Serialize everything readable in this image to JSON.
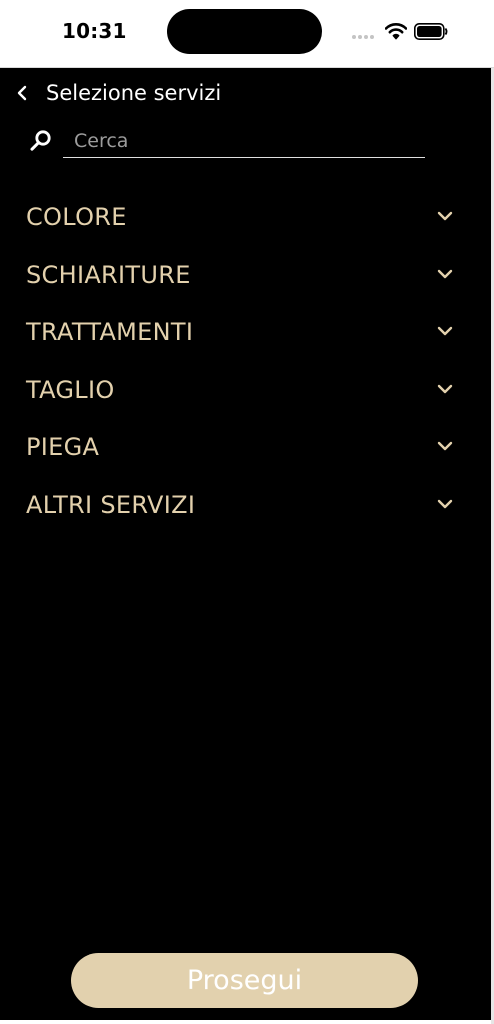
{
  "status_bar": {
    "time": "10:31"
  },
  "header": {
    "back_icon": "chevron-left-icon",
    "title": "Selezione servizi"
  },
  "search": {
    "icon": "search-icon",
    "placeholder": "Cerca",
    "value": ""
  },
  "categories": [
    {
      "label": "COLORE",
      "icon": "chevron-down-icon"
    },
    {
      "label": "SCHIARITURE",
      "icon": "chevron-down-icon"
    },
    {
      "label": "TRATTAMENTI",
      "icon": "chevron-down-icon"
    },
    {
      "label": "TAGLIO",
      "icon": "chevron-down-icon"
    },
    {
      "label": "PIEGA",
      "icon": "chevron-down-icon"
    },
    {
      "label": "ALTRI SERVIZI",
      "icon": "chevron-down-icon"
    }
  ],
  "footer": {
    "proceed_label": "Prosegui"
  },
  "colors": {
    "background": "#000000",
    "accent": "#e2d1ae",
    "category_text": "#e3d1ad",
    "text": "#ffffff"
  }
}
